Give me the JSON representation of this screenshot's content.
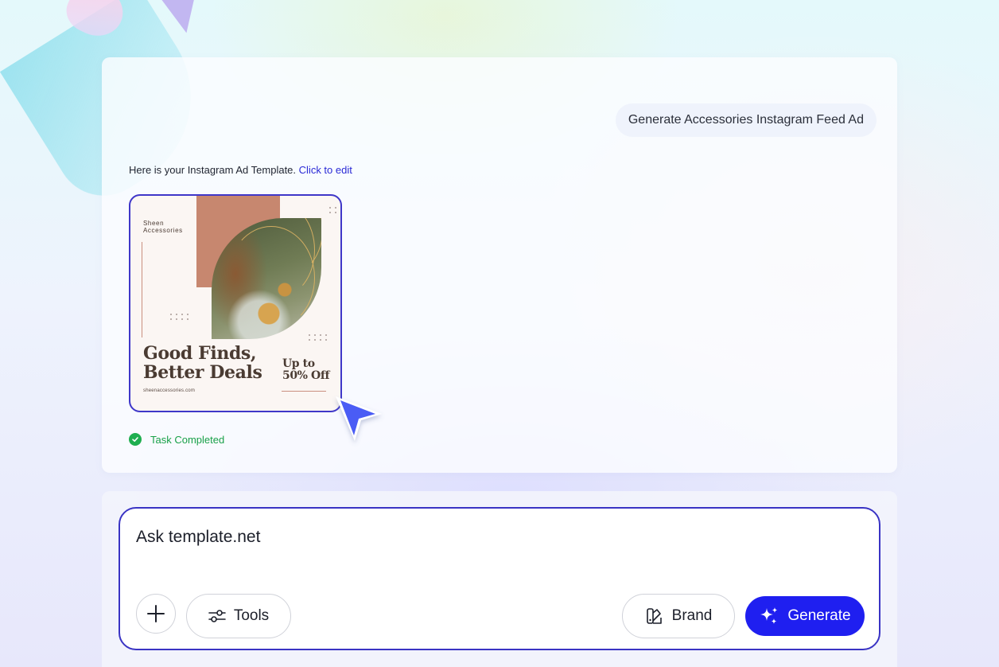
{
  "conversation": {
    "user_message": "Generate Accessories Instagram Feed Ad",
    "assistant_text": "Here is your Instagram Ad Template.",
    "edit_link_label": "Click to edit",
    "status_text": "Task Completed"
  },
  "ad_template": {
    "brand_line1": "Sheen",
    "brand_line2": "Accessories",
    "headline_line1": "Good Finds,",
    "headline_line2": "Better Deals",
    "website": "sheenaccessories.com",
    "offer_line1": "Up to",
    "offer_line2": "50% Off"
  },
  "composer": {
    "placeholder": "Ask template.net",
    "tools_label": "Tools",
    "brand_label": "Brand",
    "generate_label": "Generate"
  },
  "icons": {
    "add": "plus-icon",
    "tools": "sliders-icon",
    "brand": "brand-palette-icon",
    "generate": "sparkles-icon",
    "status": "check-circle-icon",
    "cursor": "cursor-arrow-icon"
  },
  "colors": {
    "accent": "#1f1ff0",
    "border_accent": "#3a34c4",
    "success": "#1fae50",
    "link": "#2a2ad6"
  }
}
